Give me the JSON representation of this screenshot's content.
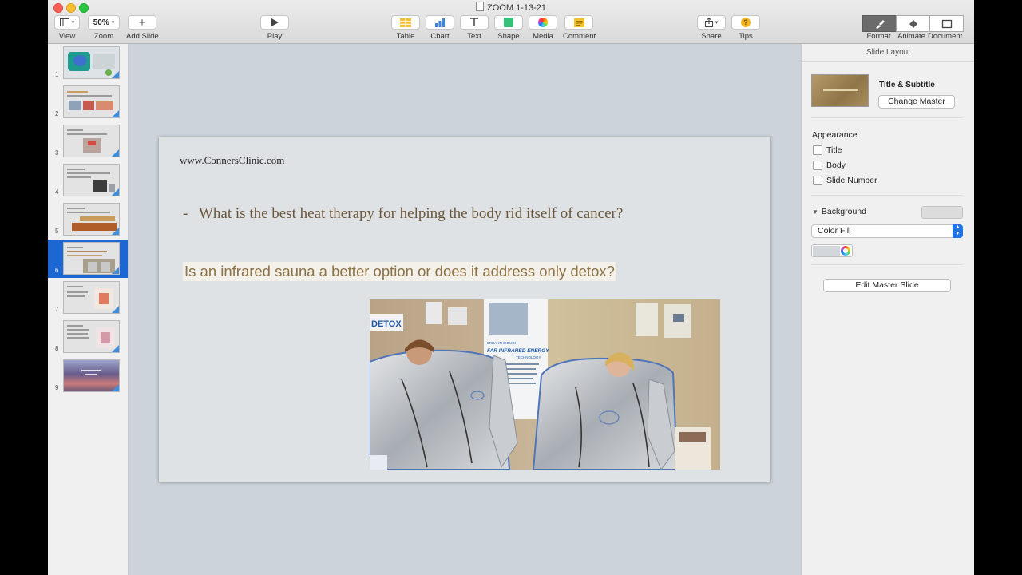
{
  "window": {
    "title": "ZOOM 1-13-21"
  },
  "toolbar": {
    "view_label": "View",
    "zoom_value": "50%",
    "zoom_label": "Zoom",
    "add_slide_label": "Add Slide",
    "play_label": "Play",
    "table_label": "Table",
    "chart_label": "Chart",
    "text_label": "Text",
    "shape_label": "Shape",
    "media_label": "Media",
    "comment_label": "Comment",
    "share_label": "Share",
    "tips_label": "Tips",
    "format_label": "Format",
    "animate_label": "Animate",
    "document_label": "Document"
  },
  "navigator": {
    "slides": [
      {
        "number": "1"
      },
      {
        "number": "2"
      },
      {
        "number": "3"
      },
      {
        "number": "4"
      },
      {
        "number": "5"
      },
      {
        "number": "6"
      },
      {
        "number": "7"
      },
      {
        "number": "8"
      },
      {
        "number": "9"
      }
    ],
    "selected": "6"
  },
  "slide": {
    "link": "www.ConnersClinic.com",
    "bullet_dash": "-",
    "bullet_text": "What is the best heat therapy for helping the body rid itself of cancer?",
    "highlight_text": "Is an infrared sauna a better option or does it address only detox?",
    "photo_text": {
      "detox": "DETOX",
      "breakthrough": "BREAKTHROUGH",
      "far_infrared": "FAR INFRARED ENERGY",
      "technology": "TECHNOLOGY"
    }
  },
  "inspector": {
    "header": "Slide Layout",
    "master_name": "Title & Subtitle",
    "change_master": "Change Master",
    "appearance_title": "Appearance",
    "checks": [
      "Title",
      "Body",
      "Slide Number"
    ],
    "background_title": "Background",
    "fill_type": "Color Fill",
    "edit_master": "Edit Master Slide"
  },
  "colors": {
    "selection": "#1c67d4",
    "slide_text": "#6b573c",
    "highlight_text": "#8c7246",
    "select_accent": "#1f74e8"
  }
}
